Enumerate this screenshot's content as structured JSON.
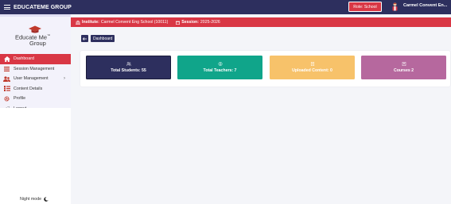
{
  "header": {
    "brand": "EDUCATEME GROUP",
    "role_label": "Role: School",
    "user_name": "Carmel Convent En..."
  },
  "sidebar": {
    "logo_line1": "Educate Me",
    "logo_tm": "™",
    "logo_line2": "Group",
    "items": [
      {
        "label": "Dashboard",
        "icon": "home-icon",
        "active": true
      },
      {
        "label": "Session Management",
        "icon": "list-icon"
      },
      {
        "label": "User Management",
        "icon": "users-icon",
        "has_submenu": true
      },
      {
        "label": "Content Details",
        "icon": "content-list-icon"
      },
      {
        "label": "Profile",
        "icon": "gear-icon"
      },
      {
        "label": "Logout",
        "icon": "logout-icon"
      }
    ],
    "night_mode_label": "Night mode"
  },
  "institute_bar": {
    "institute_label": "Institute:",
    "institute_value": "Carmel Convent Eng School (10011)",
    "session_label": "Session:",
    "session_value": "2025-2026"
  },
  "breadcrumb": {
    "current": "Dashboard"
  },
  "cards": [
    {
      "label": "Total Students: 55",
      "icon": "students-icon",
      "color": "#2d2f5e"
    },
    {
      "label": "Total Teachers: 7",
      "icon": "teachers-icon",
      "color": "#10a58a"
    },
    {
      "label": "Uploaded Content: 0",
      "icon": "upload-icon",
      "color": "#f7c26a"
    },
    {
      "label": "Courses 2",
      "icon": "courses-icon",
      "color": "#b6689e"
    }
  ],
  "colors": {
    "primary": "#2d2f5e",
    "accent": "#d93745"
  }
}
